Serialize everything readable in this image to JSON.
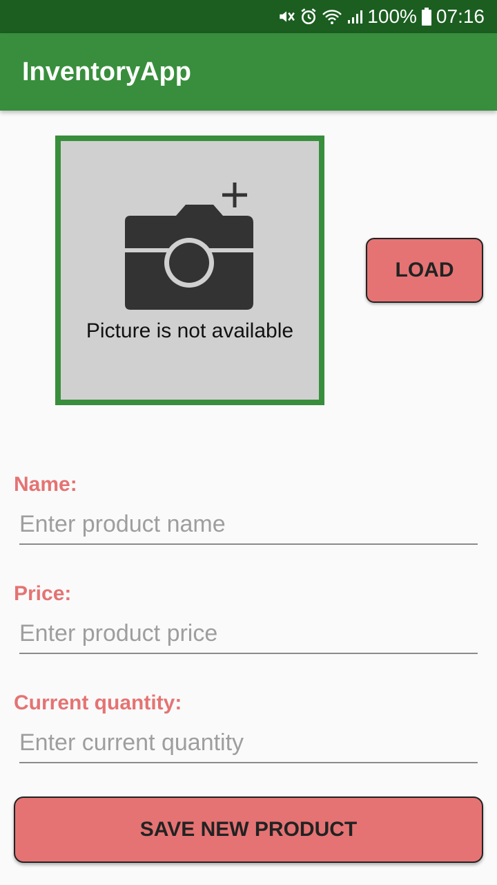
{
  "status_bar": {
    "battery": "100%",
    "time": "07:16",
    "icons": [
      "mute-icon",
      "alarm-icon",
      "wifi-icon",
      "signal-icon",
      "battery-icon"
    ]
  },
  "app_bar": {
    "title": "InventoryApp"
  },
  "image_picker": {
    "caption": "Picture is not available",
    "icon": "camera-add-icon",
    "frame_color": "#388e3c",
    "background": "#d0d0d0"
  },
  "load_button": {
    "label": "LOAD"
  },
  "form": {
    "name": {
      "label": "Name:",
      "placeholder": "Enter product name",
      "value": ""
    },
    "price": {
      "label": "Price:",
      "placeholder": "Enter product price",
      "value": ""
    },
    "quantity": {
      "label": "Current quantity:",
      "placeholder": "Enter current quantity",
      "value": ""
    }
  },
  "save_button": {
    "label": "SAVE NEW PRODUCT"
  },
  "colors": {
    "status_bar": "#1b5e20",
    "app_bar": "#388e3c",
    "accent": "#e57373",
    "background": "#fafafa"
  }
}
